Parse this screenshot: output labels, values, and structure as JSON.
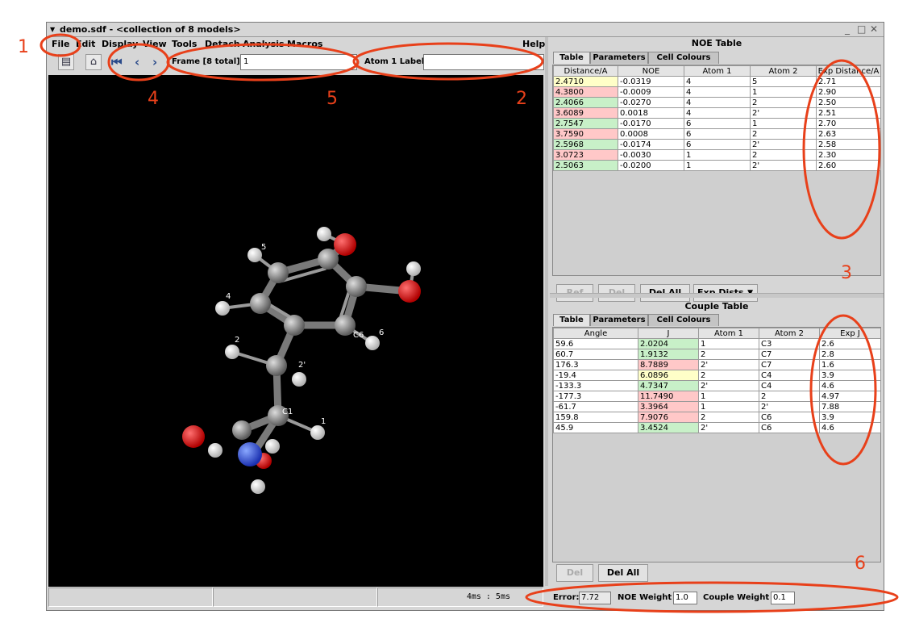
{
  "window": {
    "title": "demo.sdf - <collection of 8 models>",
    "controls": [
      "_",
      "□",
      "✕"
    ]
  },
  "menu": {
    "file": "File",
    "edit": "Edit",
    "display": "Display",
    "view": "View",
    "tools": "Tools",
    "detach": "Detach",
    "analysis": "Analysis",
    "macros": "Macros",
    "help": "Help"
  },
  "toolbar": {
    "frame_label": "Frame [8 total] :",
    "frame_value": "1",
    "atom_label": "Atom 1 Label",
    "atom_value": ""
  },
  "viewer": {
    "atom_labels": [
      "5",
      "4",
      "2",
      "6",
      "1",
      "2'",
      "C1",
      "C6"
    ]
  },
  "statusbar": {
    "timing": "4ms :   5ms"
  },
  "noe_panel": {
    "title": "NOE Table",
    "tabs": [
      "Table",
      "Parameters",
      "Cell Colours"
    ],
    "columns": [
      "Distance/A",
      "NOE",
      "Atom 1",
      "Atom 2",
      "Exp Distance/A"
    ],
    "rows": [
      [
        "2.4710",
        "-0.0319",
        "4",
        "5",
        "2.71"
      ],
      [
        "4.3800",
        "-0.0009",
        "4",
        "1",
        "2.90"
      ],
      [
        "2.4066",
        "-0.0270",
        "4",
        "2",
        "2.50"
      ],
      [
        "3.6089",
        "0.0018",
        "4",
        "2'",
        "2.51"
      ],
      [
        "2.7547",
        "-0.0170",
        "6",
        "1",
        "2.70"
      ],
      [
        "3.7590",
        "0.0008",
        "6",
        "2",
        "2.63"
      ],
      [
        "2.5968",
        "-0.0174",
        "6",
        "2'",
        "2.58"
      ],
      [
        "3.0723",
        "-0.0030",
        "1",
        "2",
        "2.30"
      ],
      [
        "2.5063",
        "-0.0200",
        "1",
        "2'",
        "2.60"
      ]
    ],
    "row_colors": [
      "ylw",
      "red",
      "grn",
      "red",
      "grn",
      "red",
      "grn",
      "red",
      "grn"
    ],
    "buttons": {
      "ref": "Ref",
      "del": "Del",
      "del_all": "Del All",
      "exp_dists": "Exp Dists"
    }
  },
  "couple_panel": {
    "title": "Couple Table",
    "tabs": [
      "Table",
      "Parameters",
      "Cell Colours"
    ],
    "columns": [
      "Angle",
      "J",
      "Atom 1",
      "Atom 2",
      "Exp J"
    ],
    "rows": [
      [
        "59.6",
        "2.0204",
        "1",
        "C3",
        "2.6"
      ],
      [
        "60.7",
        "1.9132",
        "2",
        "C7",
        "2.8"
      ],
      [
        "176.3",
        "8.7889",
        "2'",
        "C7",
        "1.6"
      ],
      [
        "-19.4",
        "6.0896",
        "2",
        "C4",
        "3.9"
      ],
      [
        "-133.3",
        "4.7347",
        "2'",
        "C4",
        "4.6"
      ],
      [
        "-177.3",
        "11.7490",
        "1",
        "2",
        "4.97"
      ],
      [
        "-61.7",
        "3.3964",
        "1",
        "2'",
        "7.88"
      ],
      [
        "159.8",
        "7.9076",
        "2",
        "C6",
        "3.9"
      ],
      [
        "45.9",
        "3.4524",
        "2'",
        "C6",
        "4.6"
      ]
    ],
    "row_colors": [
      "grn",
      "grn",
      "red",
      "ylw",
      "grn",
      "red",
      "red",
      "red",
      "grn"
    ],
    "buttons": {
      "del": "Del",
      "del_all": "Del All"
    }
  },
  "bottom": {
    "error_label": "Error:",
    "error_value": "7.72",
    "noe_weight_label": "NOE Weight",
    "noe_weight_value": "1.0",
    "couple_weight_label": "Couple Weight",
    "couple_weight_value": "0.1"
  },
  "annotations": [
    "1",
    "2",
    "3",
    "4",
    "5",
    "6"
  ],
  "colors": {
    "annotation": "#e8401a",
    "viewer_bg": "#000000",
    "oxygen": "#e00000",
    "nitrogen": "#2a50e0",
    "carbon": "#7a7a7a",
    "hydrogen": "#f4f4f4"
  }
}
